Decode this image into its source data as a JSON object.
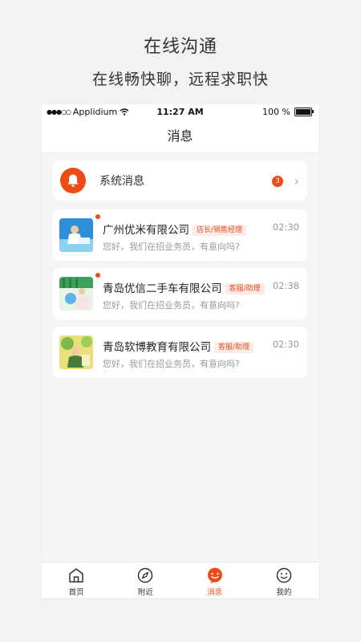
{
  "promo": {
    "title": "在线沟通",
    "subtitle": "在线畅快聊，远程求职快"
  },
  "status_bar": {
    "carrier": "Applidium",
    "time": "11:27 AM",
    "battery": "100 %"
  },
  "header": {
    "title": "消息"
  },
  "system_messages": {
    "label": "系统消息",
    "badge": "3"
  },
  "chats": [
    {
      "company": "广州优米有限公司",
      "tag": "店长/销售经理",
      "time": "02:30",
      "message": "您好，我们在招业务员，有意向吗?",
      "unread": true
    },
    {
      "company": "青岛优信二手车有限公司",
      "tag": "客服/助理",
      "time": "02:38",
      "message": "您好，我们在招业务员，有意向吗?",
      "unread": true
    },
    {
      "company": "青岛软博教育有限公司",
      "tag": "客服/助理",
      "time": "02:30",
      "message": "您好，我们在招业务员，有意向吗?",
      "unread": false
    }
  ],
  "tab_bar": {
    "items": [
      {
        "label": "首页",
        "icon": "home-icon"
      },
      {
        "label": "附近",
        "icon": "compass-icon"
      },
      {
        "label": "消息",
        "icon": "chat-icon",
        "active": true
      },
      {
        "label": "我的",
        "icon": "smile-icon"
      }
    ]
  },
  "colors": {
    "accent": "#ee4b16",
    "tag_bg": "#fdece6"
  }
}
